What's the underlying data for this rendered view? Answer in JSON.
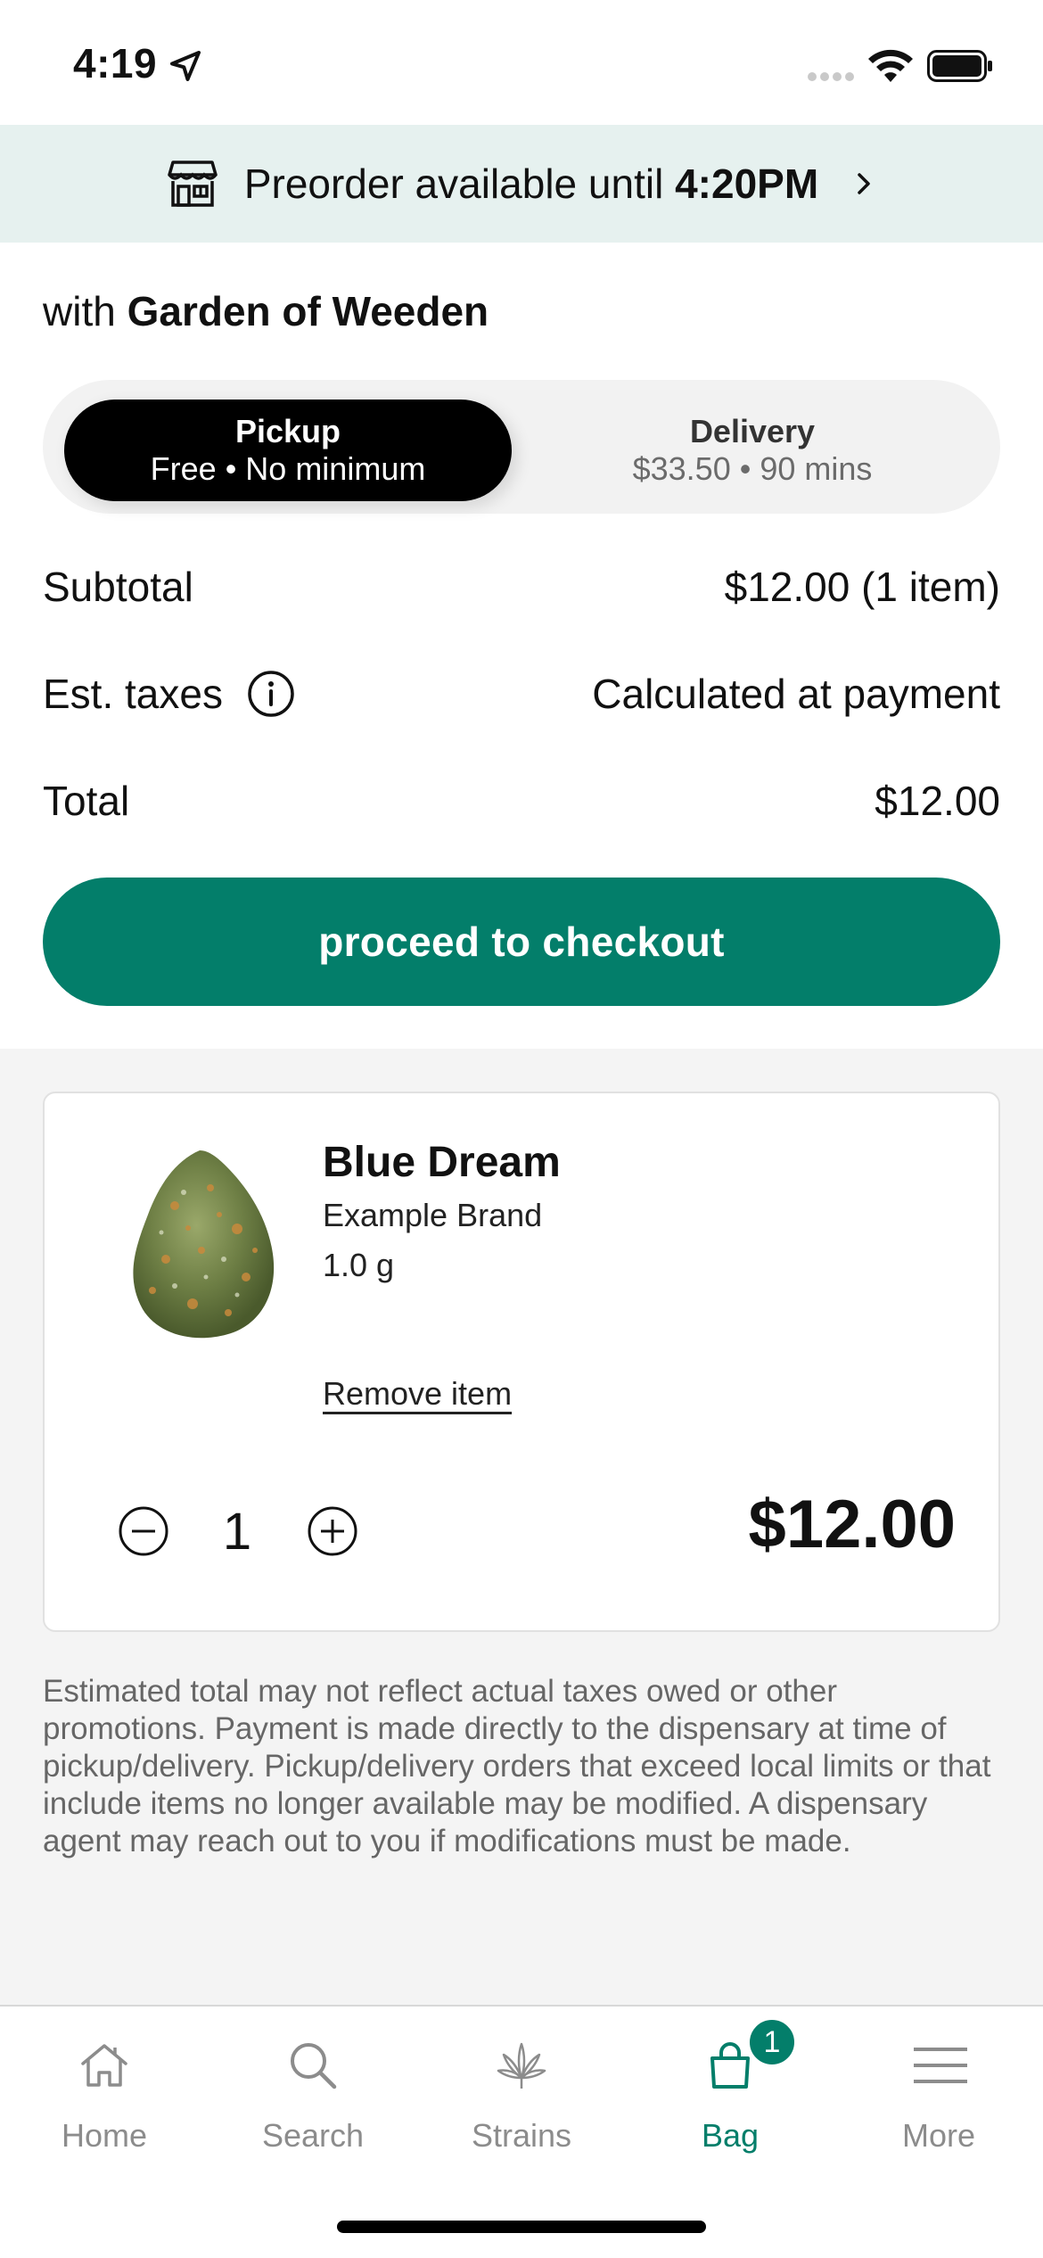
{
  "status_bar": {
    "time": "4:19"
  },
  "banner": {
    "text": "Preorder available until ",
    "time": "4:20PM"
  },
  "dispensary": {
    "prefix": "with ",
    "name": "Garden of Weeden"
  },
  "fulfillment": {
    "pickup": {
      "title": "Pickup",
      "subtitle": "Free • No minimum"
    },
    "delivery": {
      "title": "Delivery",
      "subtitle": "$33.50 • 90 mins"
    },
    "selected": "pickup"
  },
  "summary": {
    "subtotal_label": "Subtotal",
    "subtotal_value": "$12.00 (1 item)",
    "taxes_label": "Est. taxes",
    "taxes_value": "Calculated at payment",
    "total_label": "Total",
    "total_value": "$12.00"
  },
  "checkout_label": "proceed to checkout",
  "cart_item": {
    "name": "Blue Dream",
    "brand": "Example Brand",
    "weight": "1.0 g",
    "remove_label": "Remove item",
    "quantity": "1",
    "price": "$12.00"
  },
  "disclaimer": "Estimated total may not reflect actual taxes owed or other promotions. Payment is made directly to the dispensary at time of pickup/delivery. Pickup/delivery orders that exceed local limits or that include items no longer available may be modified. A dispensary agent may reach out to you if modifications must be made.",
  "tab_bar": {
    "tabs": [
      {
        "label": "Home",
        "icon": "home-icon"
      },
      {
        "label": "Search",
        "icon": "search-icon"
      },
      {
        "label": "Strains",
        "icon": "cannabis-leaf-icon"
      },
      {
        "label": "Bag",
        "icon": "bag-icon"
      },
      {
        "label": "More",
        "icon": "menu-icon"
      }
    ],
    "active": "Bag",
    "bag_badge": "1"
  },
  "colors": {
    "accent": "#037e6a",
    "banner_bg": "#e6f1ef",
    "page_bg": "#f4f4f4"
  }
}
